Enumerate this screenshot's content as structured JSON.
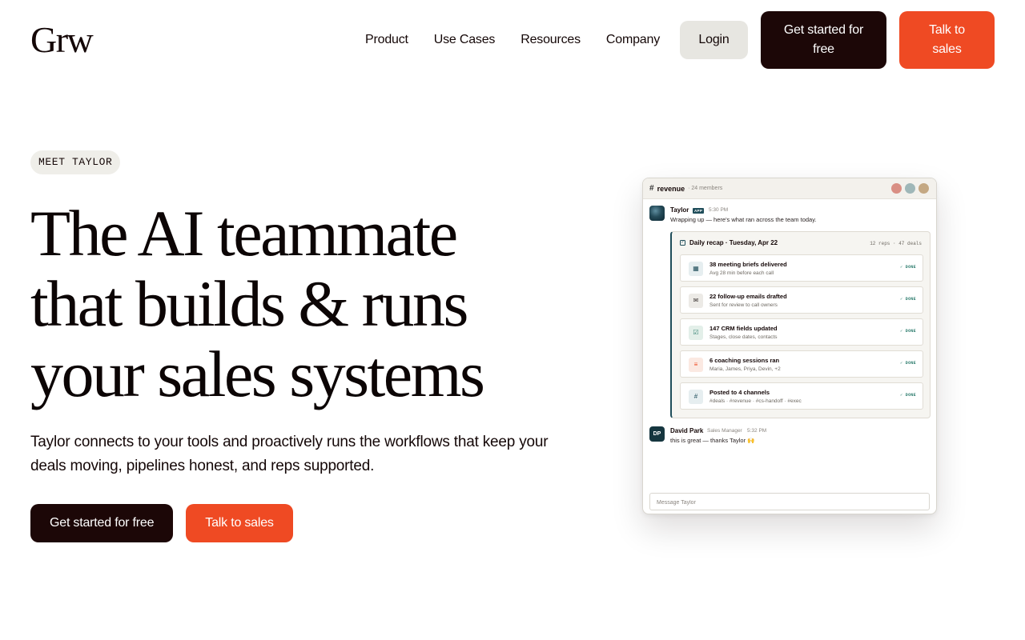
{
  "brand": {
    "logo": "Grw"
  },
  "nav": {
    "links": [
      "Product",
      "Use Cases",
      "Resources",
      "Company"
    ],
    "login": "Login",
    "get_started": "Get started for free",
    "talk_sales": "Talk to sales"
  },
  "hero": {
    "eyebrow": "MEET TAYLOR",
    "headline_lines": [
      "The AI teammate",
      "that builds & runs",
      "your sales systems"
    ],
    "subcopy": "Taylor connects to your tools and proactively runs the workflows that keep your deals moving, pipelines honest, and reps supported.",
    "cta_primary": "Get started for free",
    "cta_secondary": "Talk to sales"
  },
  "chat": {
    "channel": "revenue",
    "hash": "#",
    "members": "· 24 members",
    "header_avatar_colors": [
      "#d98f84",
      "#9fb7b8",
      "#c4a883"
    ],
    "taylor": {
      "name": "Taylor",
      "badge": "APP",
      "time": "5:30 PM",
      "text": "Wrapping up — here's what ran across the team today."
    },
    "recap": {
      "title": "Daily recap · Tuesday, Apr 22",
      "meta": "12 reps · 47 deals",
      "check": "✓",
      "items": [
        {
          "icon": "calendar-icon",
          "glyph": "▦",
          "title": "38 meeting briefs delivered",
          "sub": "Avg 28 min before each call",
          "status": "✓ DONE",
          "icon_bg": "#e6eef0",
          "icon_color": "#1f4d5a"
        },
        {
          "icon": "mail-icon",
          "glyph": "✉",
          "title": "22 follow-up emails drafted",
          "sub": "Sent for review to call owners",
          "status": "✓ DONE",
          "icon_bg": "#eceae6",
          "icon_color": "#3b3434"
        },
        {
          "icon": "checkbox-icon",
          "glyph": "☑",
          "title": "147 CRM fields updated",
          "sub": "Stages, close dates, contacts",
          "status": "✓ DONE",
          "icon_bg": "#e3efe9",
          "icon_color": "#2e7d6e"
        },
        {
          "icon": "notes-icon",
          "glyph": "≡",
          "title": "6 coaching sessions ran",
          "sub": "Maria, James, Priya, Devin, +2",
          "status": "✓ DONE",
          "icon_bg": "#fbe9e2",
          "icon_color": "#ef4a23"
        },
        {
          "icon": "hash-icon",
          "glyph": "#",
          "title": "Posted to 4 channels",
          "sub": "#deals · #revenue · #cs-handoff · #exec",
          "status": "✓ DONE",
          "icon_bg": "#e6eef0",
          "icon_color": "#1f4d5a"
        }
      ]
    },
    "reply": {
      "initials": "DP",
      "name": "David Park",
      "role": "Sales Manager",
      "time": "5:32 PM",
      "text": "this is great — thanks Taylor 🙌"
    },
    "composer_placeholder": "Message Taylor"
  },
  "colors": {
    "dark": "#1c0707",
    "orange": "#ef4a23",
    "teal": "#1f4d5a"
  }
}
